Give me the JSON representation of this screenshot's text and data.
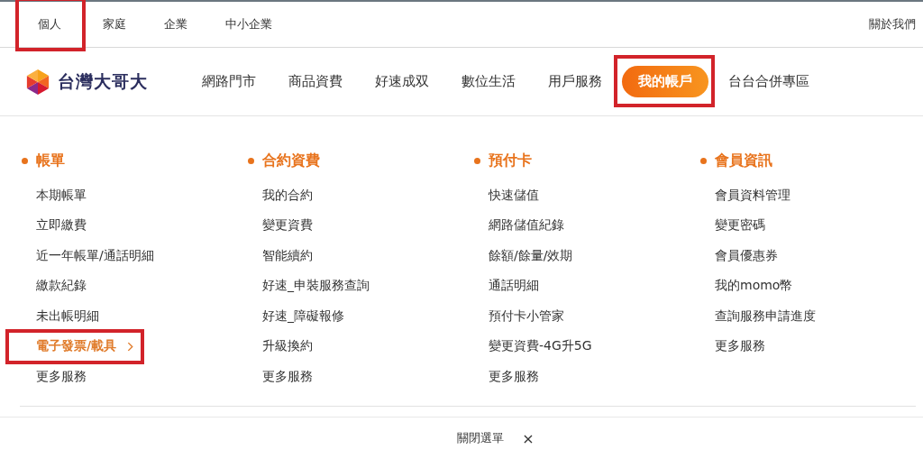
{
  "top_tabs": [
    {
      "label": "個人",
      "highlighted": true
    },
    {
      "label": "家庭",
      "highlighted": false
    },
    {
      "label": "企業",
      "highlighted": false
    },
    {
      "label": "中小企業",
      "highlighted": false
    }
  ],
  "top_right_link": "關於我們",
  "logo": {
    "text": "台灣大哥大"
  },
  "nav": [
    {
      "label": "網路門市",
      "selected": false,
      "highlighted": false
    },
    {
      "label": "商品資費",
      "selected": false,
      "highlighted": false
    },
    {
      "label": "好速成双",
      "selected": false,
      "highlighted": false
    },
    {
      "label": "數位生活",
      "selected": false,
      "highlighted": false
    },
    {
      "label": "用戶服務",
      "selected": false,
      "highlighted": false
    },
    {
      "label": "我的帳戶",
      "selected": true,
      "highlighted": true
    },
    {
      "label": "台台合併專區",
      "selected": false,
      "highlighted": false
    }
  ],
  "menu_columns": [
    {
      "heading": "帳單",
      "items": [
        {
          "label": "本期帳單",
          "selected": false,
          "highlighted": false
        },
        {
          "label": "立即繳費",
          "selected": false,
          "highlighted": false
        },
        {
          "label": "近一年帳單/通話明細",
          "selected": false,
          "highlighted": false
        },
        {
          "label": "繳款紀錄",
          "selected": false,
          "highlighted": false
        },
        {
          "label": "未出帳明細",
          "selected": false,
          "highlighted": false
        },
        {
          "label": "電子發票/載具",
          "selected": true,
          "highlighted": true
        },
        {
          "label": "更多服務",
          "selected": false,
          "highlighted": false
        }
      ]
    },
    {
      "heading": "合約資費",
      "items": [
        {
          "label": "我的合約",
          "selected": false,
          "highlighted": false
        },
        {
          "label": "變更資費",
          "selected": false,
          "highlighted": false
        },
        {
          "label": "智能續約",
          "selected": false,
          "highlighted": false
        },
        {
          "label": "好速_申裝服務查詢",
          "selected": false,
          "highlighted": false
        },
        {
          "label": "好速_障礙報修",
          "selected": false,
          "highlighted": false
        },
        {
          "label": "升級換約",
          "selected": false,
          "highlighted": false
        },
        {
          "label": "更多服務",
          "selected": false,
          "highlighted": false
        }
      ]
    },
    {
      "heading": "預付卡",
      "items": [
        {
          "label": "快速儲值",
          "selected": false,
          "highlighted": false
        },
        {
          "label": "網路儲值紀錄",
          "selected": false,
          "highlighted": false
        },
        {
          "label": "餘額/餘量/效期",
          "selected": false,
          "highlighted": false
        },
        {
          "label": "通話明細",
          "selected": false,
          "highlighted": false
        },
        {
          "label": "預付卡小管家",
          "selected": false,
          "highlighted": false
        },
        {
          "label": "變更資費-4G升5G",
          "selected": false,
          "highlighted": false
        },
        {
          "label": "更多服務",
          "selected": false,
          "highlighted": false
        }
      ]
    },
    {
      "heading": "會員資訊",
      "items": [
        {
          "label": "會員資料管理",
          "selected": false,
          "highlighted": false
        },
        {
          "label": "變更密碼",
          "selected": false,
          "highlighted": false
        },
        {
          "label": "會員優惠券",
          "selected": false,
          "highlighted": false
        },
        {
          "label": "我的momo幣",
          "selected": false,
          "highlighted": false
        },
        {
          "label": "查詢服務申請進度",
          "selected": false,
          "highlighted": false
        },
        {
          "label": "更多服務",
          "selected": false,
          "highlighted": false
        }
      ]
    }
  ],
  "close_menu": {
    "label": "關閉選單",
    "icon": "×"
  }
}
